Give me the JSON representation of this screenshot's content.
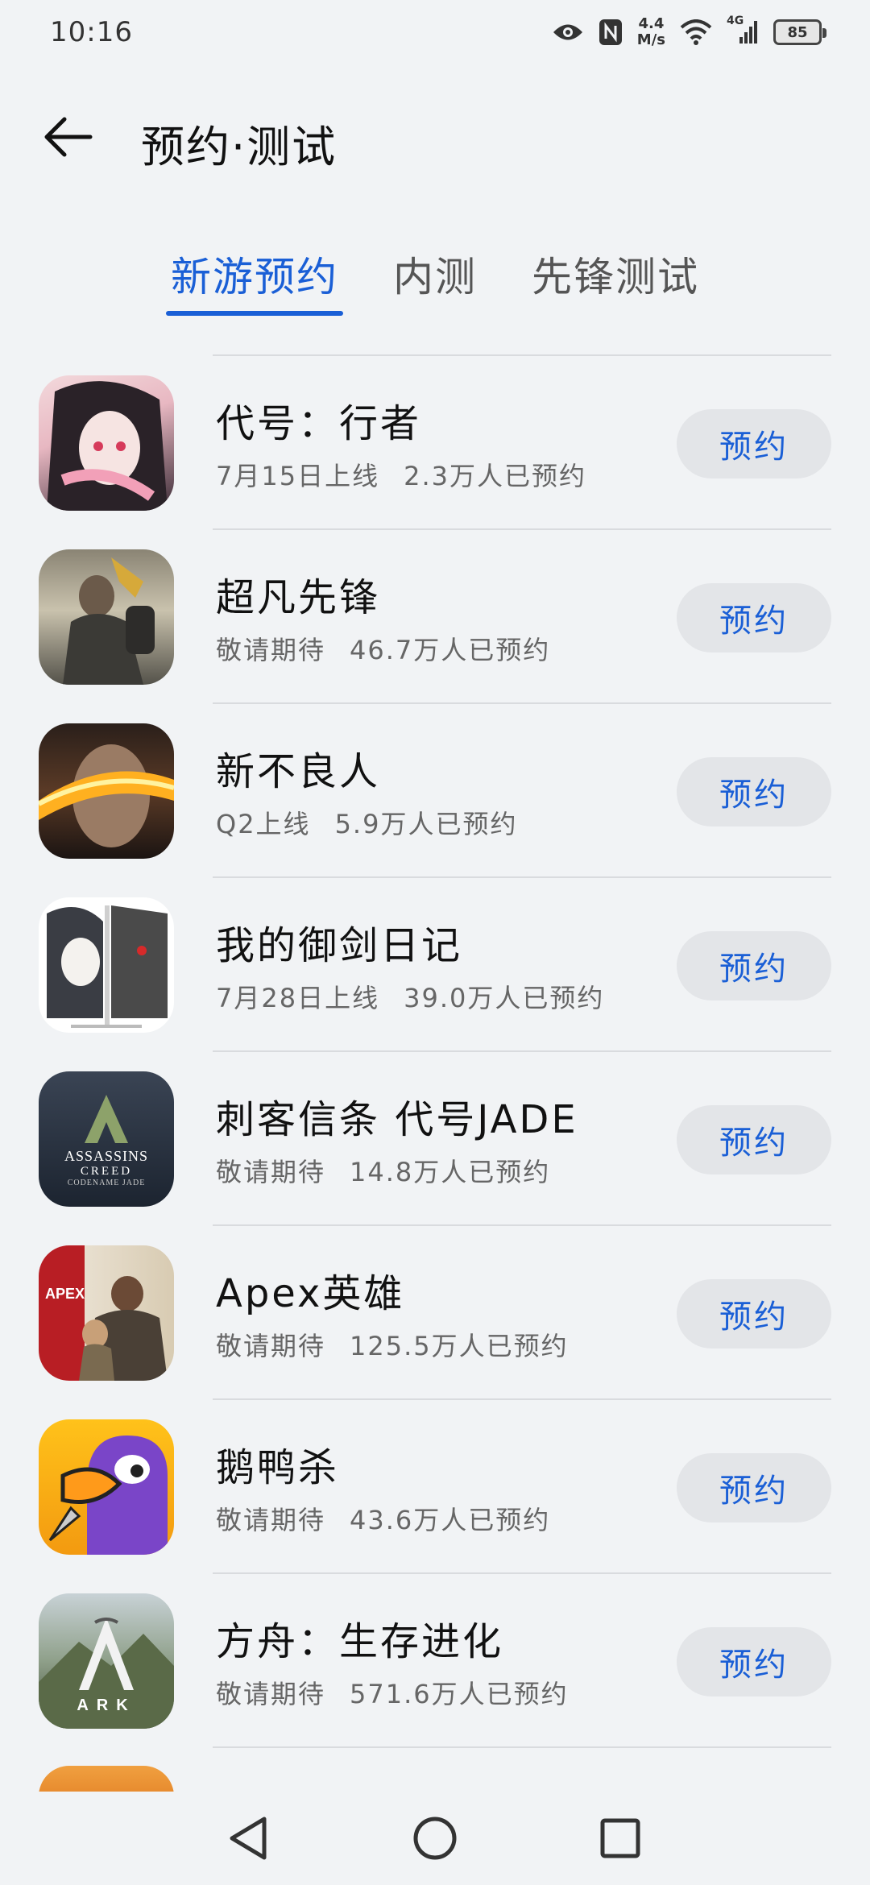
{
  "status_bar": {
    "time": "10:16",
    "net_speed_value": "4.4",
    "net_speed_unit": "M/s",
    "network_type": "4G",
    "battery_level": "85"
  },
  "header": {
    "title": "预约·测试"
  },
  "tabs": [
    {
      "label": "新游预约",
      "active": true
    },
    {
      "label": "内测",
      "active": false
    },
    {
      "label": "先锋测试",
      "active": false
    }
  ],
  "games": [
    {
      "name": "代号：行者",
      "release": "7月15日上线",
      "reservations": "2.3万人已预约",
      "button": "预约",
      "icon": "game-icon-xingzhe"
    },
    {
      "name": "超凡先锋",
      "release": "敬请期待",
      "reservations": "46.7万人已预约",
      "button": "预约",
      "icon": "game-icon-chaofan"
    },
    {
      "name": "新不良人",
      "release": "Q2上线",
      "reservations": "5.9万人已预约",
      "button": "预约",
      "icon": "game-icon-buliangren"
    },
    {
      "name": "我的御剑日记",
      "release": "7月28日上线",
      "reservations": "39.0万人已预约",
      "button": "预约",
      "icon": "game-icon-yujian"
    },
    {
      "name": "刺客信条 代号JADE",
      "release": "敬请期待",
      "reservations": "14.8万人已预约",
      "button": "预约",
      "icon": "game-icon-assassins-creed"
    },
    {
      "name": "Apex英雄",
      "release": "敬请期待",
      "reservations": "125.5万人已预约",
      "button": "预约",
      "icon": "game-icon-apex"
    },
    {
      "name": "鹅鸭杀",
      "release": "敬请期待",
      "reservations": "43.6万人已预约",
      "button": "预约",
      "icon": "game-icon-goose"
    },
    {
      "name": "方舟：生存进化",
      "release": "敬请期待",
      "reservations": "571.6万人已预约",
      "button": "预约",
      "icon": "game-icon-ark"
    }
  ],
  "icon_texts": {
    "assassins": "ASSASSINS",
    "creed": "CREED",
    "jade": "CODENAME JADE",
    "apex": "APEX",
    "ark": "ARK"
  },
  "colors": {
    "accent": "#1a5fd6",
    "background": "#f1f3f5",
    "button_bg": "#e3e5e8"
  }
}
